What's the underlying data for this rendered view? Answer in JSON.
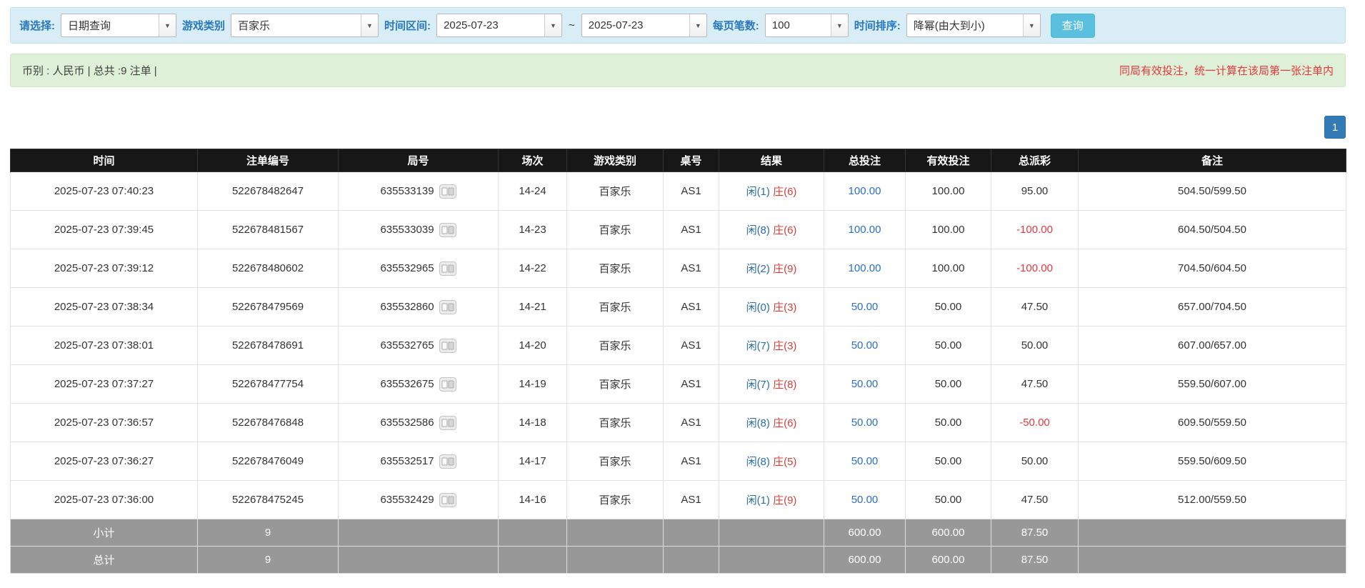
{
  "filters": {
    "query_type": {
      "label": "请选择:",
      "value": "日期查询"
    },
    "game_type": {
      "label": "游戏类别",
      "value": "百家乐"
    },
    "time_range": {
      "label": "时间区间:",
      "from": "2025-07-23",
      "separator": "~",
      "to": "2025-07-23"
    },
    "page_size": {
      "label": "每页笔数:",
      "value": "100"
    },
    "sort": {
      "label": "时间排序:",
      "value": "降幂(由大到小)"
    },
    "search_button_label": "查询"
  },
  "summary": {
    "info": "币别 : 人民币 | 总共 :9 注单 |",
    "notice": "同局有效投注，统一计算在该局第一张注单内"
  },
  "pagination": {
    "current_page": "1"
  },
  "table": {
    "headers": [
      "时间",
      "注单编号",
      "局号",
      "场次",
      "游戏类别",
      "桌号",
      "结果",
      "总投注",
      "有效投注",
      "总派彩",
      "备注"
    ],
    "rows": [
      {
        "time": "2025-07-23 07:40:23",
        "bet_id": "522678482647",
        "round_id": "635533139",
        "session": "14-24",
        "game": "百家乐",
        "table_no": "AS1",
        "player": "闲(1)",
        "banker": "庄(6)",
        "total_bet": "100.00",
        "valid_bet": "100.00",
        "payout": "95.00",
        "note": "504.50/599.50"
      },
      {
        "time": "2025-07-23 07:39:45",
        "bet_id": "522678481567",
        "round_id": "635533039",
        "session": "14-23",
        "game": "百家乐",
        "table_no": "AS1",
        "player": "闲(8)",
        "banker": "庄(6)",
        "total_bet": "100.00",
        "valid_bet": "100.00",
        "payout": "-100.00",
        "note": "604.50/504.50"
      },
      {
        "time": "2025-07-23 07:39:12",
        "bet_id": "522678480602",
        "round_id": "635532965",
        "session": "14-22",
        "game": "百家乐",
        "table_no": "AS1",
        "player": "闲(2)",
        "banker": "庄(9)",
        "total_bet": "100.00",
        "valid_bet": "100.00",
        "payout": "-100.00",
        "note": "704.50/604.50"
      },
      {
        "time": "2025-07-23 07:38:34",
        "bet_id": "522678479569",
        "round_id": "635532860",
        "session": "14-21",
        "game": "百家乐",
        "table_no": "AS1",
        "player": "闲(0)",
        "banker": "庄(3)",
        "total_bet": "50.00",
        "valid_bet": "50.00",
        "payout": "47.50",
        "note": "657.00/704.50"
      },
      {
        "time": "2025-07-23 07:38:01",
        "bet_id": "522678478691",
        "round_id": "635532765",
        "session": "14-20",
        "game": "百家乐",
        "table_no": "AS1",
        "player": "闲(7)",
        "banker": "庄(3)",
        "total_bet": "50.00",
        "valid_bet": "50.00",
        "payout": "50.00",
        "note": "607.00/657.00"
      },
      {
        "time": "2025-07-23 07:37:27",
        "bet_id": "522678477754",
        "round_id": "635532675",
        "session": "14-19",
        "game": "百家乐",
        "table_no": "AS1",
        "player": "闲(7)",
        "banker": "庄(8)",
        "total_bet": "50.00",
        "valid_bet": "50.00",
        "payout": "47.50",
        "note": "559.50/607.00"
      },
      {
        "time": "2025-07-23 07:36:57",
        "bet_id": "522678476848",
        "round_id": "635532586",
        "session": "14-18",
        "game": "百家乐",
        "table_no": "AS1",
        "player": "闲(8)",
        "banker": "庄(6)",
        "total_bet": "50.00",
        "valid_bet": "50.00",
        "payout": "-50.00",
        "note": "609.50/559.50"
      },
      {
        "time": "2025-07-23 07:36:27",
        "bet_id": "522678476049",
        "round_id": "635532517",
        "session": "14-17",
        "game": "百家乐",
        "table_no": "AS1",
        "player": "闲(8)",
        "banker": "庄(5)",
        "total_bet": "50.00",
        "valid_bet": "50.00",
        "payout": "50.00",
        "note": "559.50/609.50"
      },
      {
        "time": "2025-07-23 07:36:00",
        "bet_id": "522678475245",
        "round_id": "635532429",
        "session": "14-16",
        "game": "百家乐",
        "table_no": "AS1",
        "player": "闲(1)",
        "banker": "庄(9)",
        "total_bet": "50.00",
        "valid_bet": "50.00",
        "payout": "47.50",
        "note": "512.00/559.50"
      }
    ],
    "subtotal": {
      "label": "小计",
      "count": "9",
      "total_bet": "600.00",
      "valid_bet": "600.00",
      "payout": "87.50"
    },
    "grand_total": {
      "label": "总计",
      "count": "9",
      "total_bet": "600.00",
      "valid_bet": "600.00",
      "payout": "87.50"
    }
  },
  "icons": {
    "dropdown_caret": "▼",
    "round_detail": "game-result-icon"
  },
  "colors": {
    "filter_bar_bg": "#d9edf7",
    "filter_label_blue": "#2878be",
    "search_button_bg": "#5bc0de",
    "summary_bar_bg": "#dff0d8",
    "notice_red": "#e4393c",
    "pagination_blue": "#337ab7",
    "table_header_bg": "#171717",
    "table_footer_bg": "#989898",
    "player_blue": "#2b6dad",
    "banker_red": "#d43f3a",
    "bet_link_blue": "#2a6fc9",
    "negative_red": "#e4393c"
  }
}
